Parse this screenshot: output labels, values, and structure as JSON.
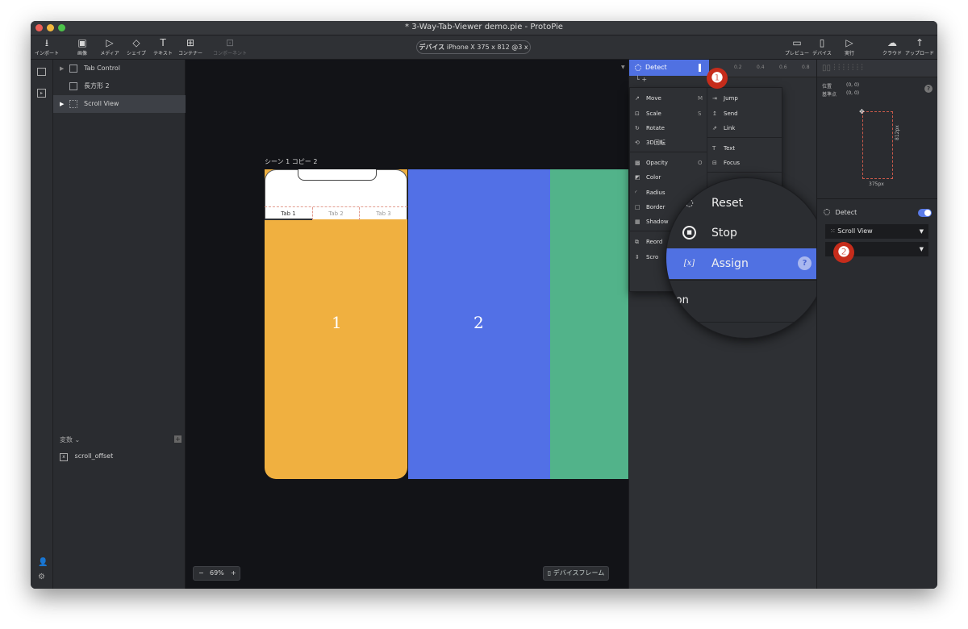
{
  "window": {
    "title": "* 3-Way-Tab-Viewer demo.pie - ProtoPie",
    "traffic_colors": [
      "#ee5f57",
      "#f3b73e",
      "#4cc44a"
    ]
  },
  "toolbar": {
    "import": "インポート",
    "image": "画像",
    "media": "メディア",
    "shape": "シェイプ",
    "text": "テキスト",
    "container": "コンテナー",
    "component": "コンポーネント",
    "device_label": "デバイス",
    "device_value": "iPhone X  375 x 812  @3 x",
    "preview": "プレビュー",
    "device": "デバイス",
    "run": "実行",
    "cloud": "クラウド",
    "upload": "アップロード"
  },
  "layers": [
    {
      "label": "Tab Control"
    },
    {
      "label": "長方形 2"
    },
    {
      "label": "Scroll View"
    }
  ],
  "variables": {
    "header": "変数",
    "items": [
      "scroll_offset"
    ]
  },
  "canvas": {
    "scene_label": "シーン 1 コピー 2",
    "tabs": [
      "Tab 1",
      "Tab 2",
      "Tab 3"
    ],
    "page_numbers": [
      "1",
      "2"
    ],
    "zoom": "69%",
    "device_frame": "デバイスフレーム",
    "colors": {
      "orange": "#f0b040",
      "blue": "#5270e6",
      "green": "#52b38a"
    }
  },
  "interaction": {
    "trigger": "Detect",
    "ruler": [
      "0.2",
      "0.4",
      "0.6",
      "0.8"
    ],
    "menu_left": [
      {
        "label": "Move",
        "shortcut": "M",
        "icon": "move-icon"
      },
      {
        "label": "Scale",
        "shortcut": "S",
        "icon": "scale-icon"
      },
      {
        "label": "Rotate",
        "shortcut": "",
        "icon": "rotate-icon"
      },
      {
        "label": "3D回転",
        "shortcut": "",
        "icon": "rotate3d-icon"
      },
      {
        "label": "Opacity",
        "shortcut": "O",
        "icon": "opacity-icon"
      },
      {
        "label": "Color",
        "shortcut": "",
        "icon": "color-icon"
      },
      {
        "label": "Radius",
        "shortcut": "",
        "icon": "radius-icon"
      },
      {
        "label": "Border",
        "shortcut": "",
        "icon": "border-icon"
      },
      {
        "label": "Shadow",
        "shortcut": "",
        "icon": "shadow-icon"
      },
      {
        "label": "Reord",
        "shortcut": "",
        "icon": "reorder-icon"
      },
      {
        "label": "Scro",
        "shortcut": "",
        "icon": "scroll-icon"
      }
    ],
    "menu_right": [
      {
        "label": "Jump",
        "icon": "jump-icon"
      },
      {
        "label": "Send",
        "icon": "send-icon"
      },
      {
        "label": "Link",
        "icon": "link-icon"
      },
      {
        "label": "Text",
        "icon": "text-icon"
      },
      {
        "label": "Focus",
        "icon": "focus-icon"
      }
    ],
    "zoomed": [
      {
        "label": "Reset",
        "icon": "reset-icon"
      },
      {
        "label": "Stop",
        "icon": "stop-icon"
      },
      {
        "label": "Assign",
        "icon": "assign-icon",
        "highlighted": true
      }
    ],
    "zoom_cut_text": "ion",
    "accent": "#5071e2"
  },
  "properties": {
    "position_label": "位置",
    "position_value": "(0, 0)",
    "anchor_label": "基準点",
    "anchor_value": "(0, 0)",
    "dim_h": "812px",
    "dim_w": "375px",
    "trigger": "Detect",
    "target": "Scroll View",
    "property_value": ""
  },
  "callouts": [
    "❶",
    "❷"
  ]
}
